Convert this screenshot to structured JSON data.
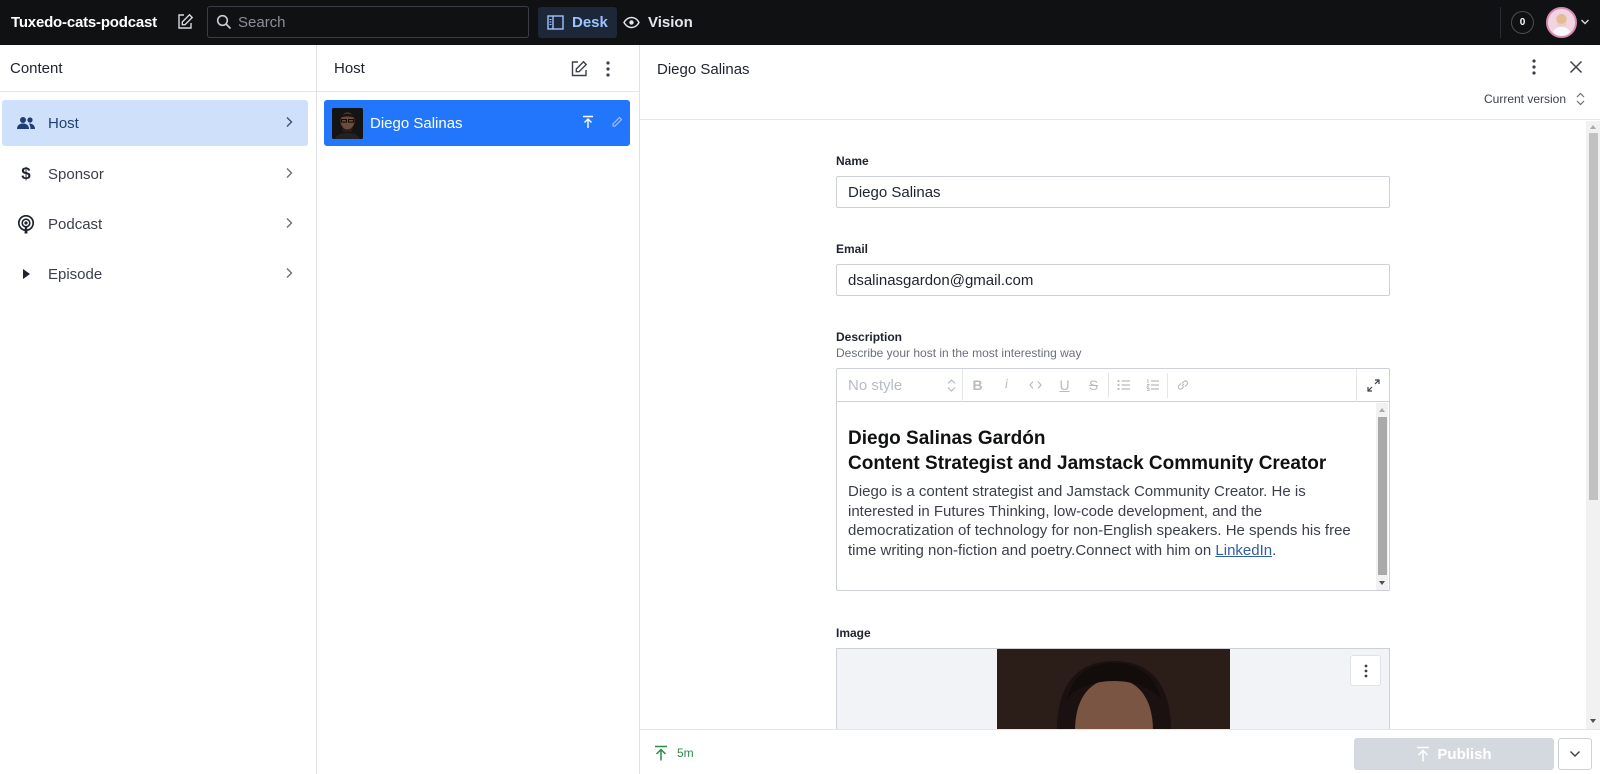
{
  "topbar": {
    "project_name": "Tuxedo-cats-podcast",
    "search_placeholder": "Search",
    "tools": [
      {
        "label": "Desk",
        "icon": "desk-icon",
        "active": true
      },
      {
        "label": "Vision",
        "icon": "eye-icon",
        "active": false
      }
    ],
    "notification_count": "0"
  },
  "content_pane": {
    "title": "Content",
    "items": [
      {
        "label": "Host",
        "icon": "users-icon",
        "active": true
      },
      {
        "label": "Sponsor",
        "icon": "dollar-icon",
        "active": false
      },
      {
        "label": "Podcast",
        "icon": "podcast-icon",
        "active": false
      },
      {
        "label": "Episode",
        "icon": "play-icon",
        "active": false
      }
    ]
  },
  "list_pane": {
    "title": "Host",
    "documents": [
      {
        "label": "Diego Salinas",
        "selected": true
      }
    ]
  },
  "editor": {
    "title": "Diego Salinas",
    "version": "Current version",
    "fields": {
      "name": {
        "label": "Name",
        "value": "Diego Salinas"
      },
      "email": {
        "label": "Email",
        "value": "dsalinasgardon@gmail.com"
      },
      "description": {
        "label": "Description",
        "help": "Describe your host in the most interesting way",
        "style_select": "No style",
        "heading_line1": "Diego Salinas Gardón",
        "heading_line2": "Content Strategist and Jamstack Community Creator",
        "paragraph": "Diego is a content strategist and Jamstack Community Creator. He is interested in Futures Thinking, low-code development, and the democratization of technology for non-English speakers. He spends his free time writing non-fiction and poetry.Connect with him on ",
        "link_text": "LinkedIn",
        "paragraph_end": "."
      },
      "image": {
        "label": "Image"
      }
    },
    "footer": {
      "status_time": "5m",
      "publish_label": "Publish"
    }
  },
  "colors": {
    "topbar_bg": "#101112",
    "accent_blue": "#2276fc",
    "active_nav_bg": "#cfe0fb",
    "published_green": "#2c8a4b"
  }
}
